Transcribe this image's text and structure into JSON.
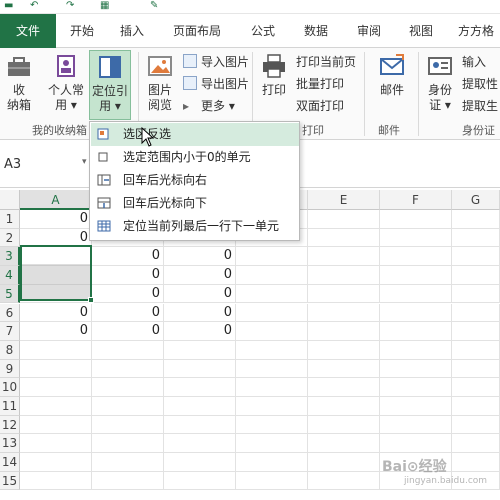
{
  "tabs": [
    "文件",
    "开始",
    "插入",
    "页面布局",
    "公式",
    "数据",
    "审阅",
    "视图",
    "方方格"
  ],
  "ribbon": {
    "my_toolbox": {
      "label_line1": "收",
      "label_line2": "纳箱"
    },
    "personal": {
      "label_line1": "个人常",
      "label_line2": "用 ▾"
    },
    "locate": {
      "label_line1": "定位引",
      "label_line2": "用 ▾"
    },
    "img_view": {
      "label_line1": "图片",
      "label_line2": "阅览"
    },
    "import_img": "导入图片",
    "export_img": "导出图片",
    "more": "更多 ▾",
    "print": "打印",
    "print_current": "打印当前页",
    "batch_print": "批量打印",
    "duplex_print": "双面打印",
    "mail": "邮件",
    "id_card_line1": "身份",
    "id_card_line2": "证 ▾",
    "input": "输入",
    "take_sex": "提取性",
    "take_birth": "提取生",
    "group_my_toolbox": "我的收纳箱",
    "group_print": "打印",
    "group_mail": "邮件",
    "group_id": "身份证"
  },
  "formula_bar": {
    "name_box": "A3"
  },
  "menu": {
    "items": [
      "选区反选",
      "选定范围内小于0的单元",
      "回车后光标向右",
      "回车后光标向下",
      "定位当前列最后一行下一单元"
    ]
  },
  "grid": {
    "columns": [
      "A",
      "B",
      "C",
      "D",
      "E",
      "F",
      "G"
    ],
    "rows": [
      "1",
      "2",
      "3",
      "4",
      "5",
      "6",
      "7",
      "8",
      "9",
      "10",
      "11",
      "12",
      "13",
      "14",
      "15"
    ],
    "cells": {
      "A1": "0",
      "A2": "0",
      "A6": "0",
      "A7": "0",
      "B3": "0",
      "B4": "0",
      "B5": "0",
      "B6": "0",
      "B7": "0",
      "C3": "0",
      "C4": "0",
      "C5": "0",
      "C6": "0",
      "C7": "0"
    }
  },
  "watermark": {
    "text": "Bai⊙经验",
    "sub": "jingyan.baidu.com"
  },
  "colors": {
    "excel_green": "#217346",
    "highlight": "#d5ebde"
  }
}
